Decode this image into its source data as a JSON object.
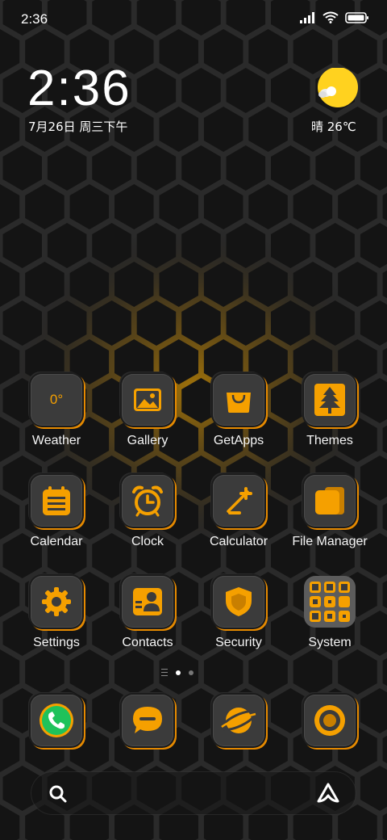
{
  "status_bar": {
    "time": "2:36",
    "icons": [
      "signal-icon",
      "wifi-icon",
      "battery-icon"
    ]
  },
  "clock_widget": {
    "time": "2:36",
    "date": "7月26日 周三下午"
  },
  "weather_widget": {
    "icon": "sun-cloud-icon",
    "text": "晴 26℃"
  },
  "apps": [
    {
      "label": "Weather",
      "icon": "weather-icon",
      "glyph": "0°"
    },
    {
      "label": "Gallery",
      "icon": "gallery-icon"
    },
    {
      "label": "GetApps",
      "icon": "shopping-bag-icon"
    },
    {
      "label": "Themes",
      "icon": "tree-icon"
    },
    {
      "label": "Calendar",
      "icon": "calendar-icon"
    },
    {
      "label": "Clock",
      "icon": "alarm-clock-icon"
    },
    {
      "label": "Calculator",
      "icon": "calculator-icon"
    },
    {
      "label": "File Manager",
      "icon": "folder-icon"
    },
    {
      "label": "Settings",
      "icon": "gear-icon"
    },
    {
      "label": "Contacts",
      "icon": "contact-card-icon"
    },
    {
      "label": "Security",
      "icon": "shield-icon"
    },
    {
      "label": "System",
      "icon": "folder-grid-icon"
    }
  ],
  "dock": [
    {
      "icon": "phone-icon"
    },
    {
      "icon": "message-icon"
    },
    {
      "icon": "browser-planet-icon"
    },
    {
      "icon": "camera-icon"
    }
  ],
  "pager": {
    "pages": 2,
    "active": 1
  },
  "search_bar": {
    "left_icon": "search-icon",
    "right_icon": "assistant-icon"
  },
  "colors": {
    "accent": "#f5a000",
    "background": "#161616",
    "honeycomb_glow": "#c78a00"
  }
}
